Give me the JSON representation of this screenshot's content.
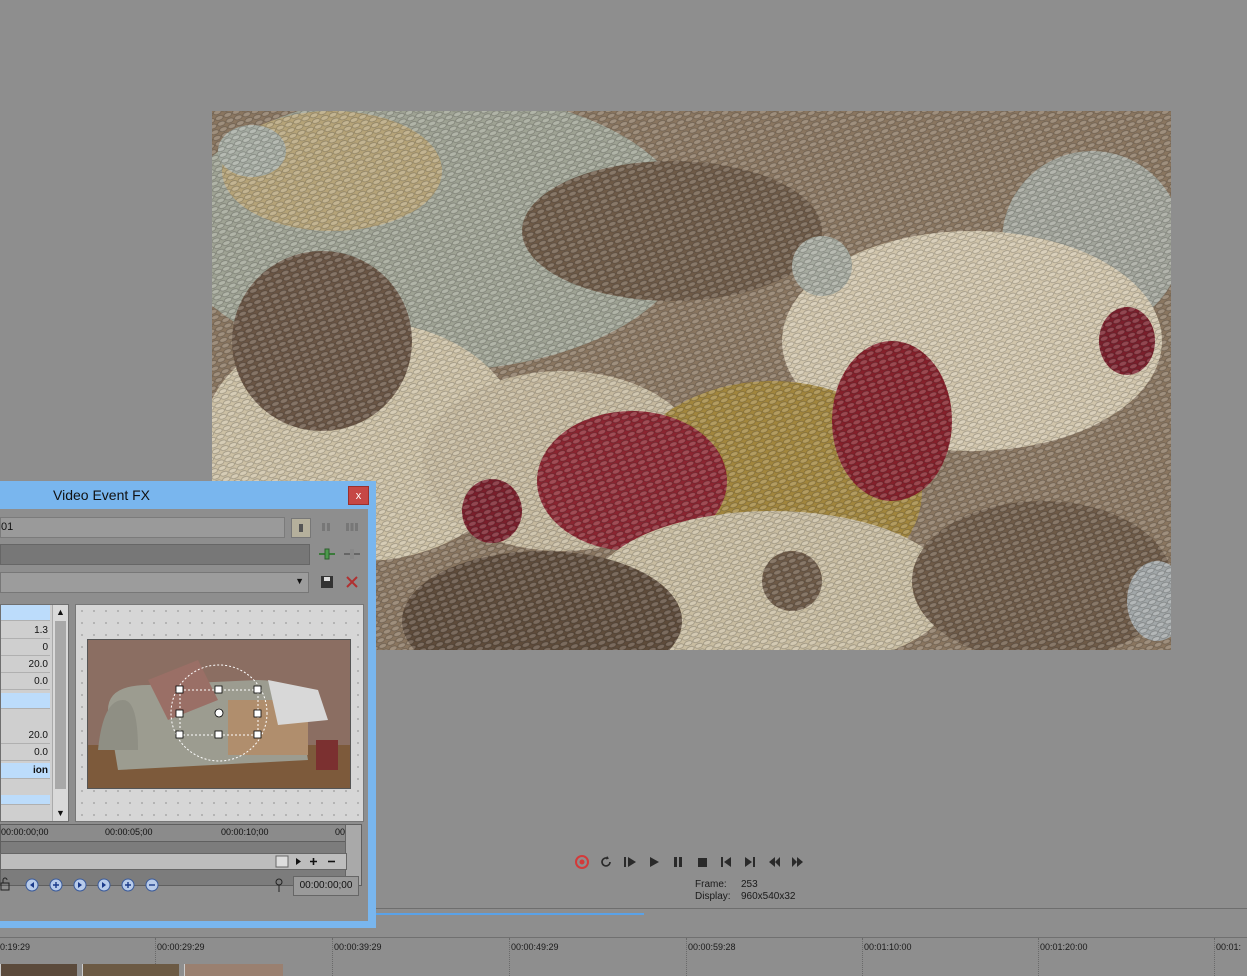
{
  "fx_window": {
    "title": "Video Event FX",
    "chain_value": "01",
    "close_symbol": "x",
    "param_values": [
      "1.3",
      "0",
      "20.0",
      "0.0",
      "",
      "20.0",
      "0.0",
      "ion"
    ],
    "keyframe_ruler": [
      "00:00:00;00",
      "00:00:05;00",
      "00:00:10;00",
      "00"
    ],
    "timecode": "00:00:00;00"
  },
  "preview_info": {
    "frame_label": "Frame:",
    "frame_value": "253",
    "display_label": "Display:",
    "display_value": "960x540x32"
  },
  "timeline_ruler": [
    "0:19:29",
    "00:00:29:29",
    "00:00:39:29",
    "00:00:49:29",
    "00:00:59:28",
    "00:01:10:00",
    "00:01:20:00",
    "00:01:"
  ],
  "icons": {
    "transport": [
      "record-icon",
      "loop-icon",
      "play-from-start-icon",
      "play-icon",
      "pause-icon",
      "stop-icon",
      "go-to-start-icon",
      "go-to-end-icon",
      "previous-frame-icon",
      "next-frame-icon"
    ]
  },
  "colors": {
    "window_frame": "#79b6ee",
    "close_button": "#c64745",
    "background": "#8e8e8e",
    "record": "#d33a3a",
    "progress": "#5aa2e8"
  }
}
